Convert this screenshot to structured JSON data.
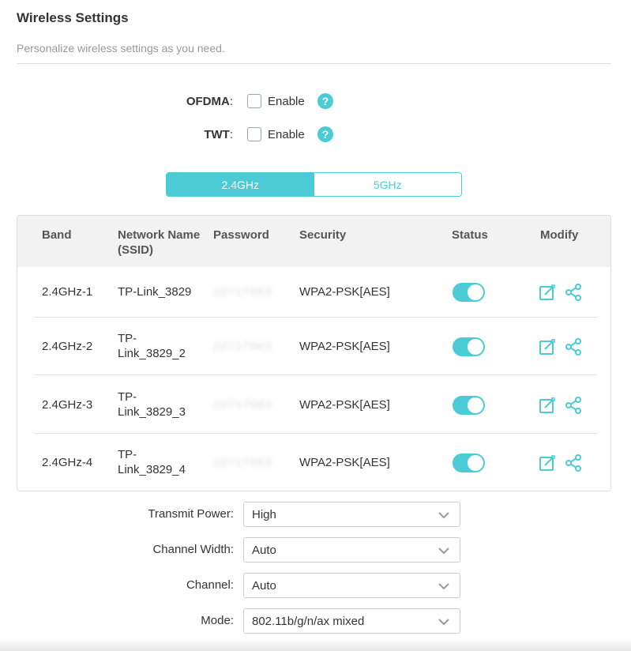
{
  "header": {
    "title": "Wireless Settings",
    "subtitle": "Personalize wireless settings as you need."
  },
  "options": {
    "ofdma": {
      "label": "OFDMA",
      "colon": ":",
      "checkbox_text": "Enable",
      "checked": false,
      "help": "?"
    },
    "twt": {
      "label": "TWT",
      "colon": ":",
      "checkbox_text": "Enable",
      "checked": false,
      "help": "?"
    }
  },
  "band_tabs": [
    {
      "label": "2.4GHz",
      "active": true
    },
    {
      "label": "5GHz",
      "active": false
    }
  ],
  "table": {
    "columns": [
      "Band",
      "Network Name (SSID)",
      "Password",
      "Security",
      "Status",
      "Modify"
    ],
    "rows": [
      {
        "band": "2.4GHz-1",
        "ssid": "TP-Link_3829",
        "password": "22717963",
        "security": "WPA2-PSK[AES]",
        "status_on": true
      },
      {
        "band": "2.4GHz-2",
        "ssid": "TP-Link_3829_2",
        "password": "22717963",
        "security": "WPA2-PSK[AES]",
        "status_on": true
      },
      {
        "band": "2.4GHz-3",
        "ssid": "TP-Link_3829_3",
        "password": "22717963",
        "security": "WPA2-PSK[AES]",
        "status_on": true
      },
      {
        "band": "2.4GHz-4",
        "ssid": "TP-Link_3829_4",
        "password": "22717963",
        "security": "WPA2-PSK[AES]",
        "status_on": true
      }
    ]
  },
  "form": {
    "transmit_power": {
      "label": "Transmit Power:",
      "value": "High"
    },
    "channel_width": {
      "label": "Channel Width:",
      "value": "Auto"
    },
    "channel": {
      "label": "Channel:",
      "value": "Auto"
    },
    "mode": {
      "label": "Mode:",
      "value": "802.11b/g/n/ax mixed"
    }
  },
  "colors": {
    "accent": "#4acbd6",
    "text": "#333333",
    "muted": "#999999",
    "header_bg": "#f2f2f2"
  },
  "icons": {
    "help": "help-icon",
    "edit": "edit-icon",
    "share": "share-icon",
    "dropdown": "chevron-down-icon"
  }
}
